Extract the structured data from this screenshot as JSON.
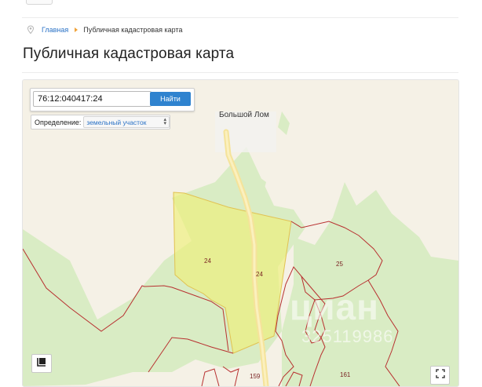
{
  "breadcrumb": {
    "home_label": "Главная",
    "current_label": "Публичная кадастровая карта"
  },
  "page": {
    "title": "Публичная кадастровая карта"
  },
  "search": {
    "cadastral_number": "76:12:040417:24",
    "find_button_label": "Найти"
  },
  "definition": {
    "label": "Определение:",
    "selected_option": "земельный участок"
  },
  "map": {
    "place_label": "Большой Лом",
    "parcel_labels": {
      "p24a": "24",
      "p24b": "24",
      "p25": "25",
      "p159": "159",
      "p161": "161"
    },
    "watermark_brand": "циан",
    "watermark_phone": "325119986",
    "colors": {
      "land": "#f5f1e6",
      "forest": "#d9ecc4",
      "selected_parcel": "#eef07a",
      "parcel_border": "#b83030",
      "road": "#f5e39a",
      "accent": "#2f83cf"
    }
  },
  "icons": {
    "breadcrumb": "map-pin-icon",
    "layers": "layers-icon",
    "fullscreen": "fullscreen-icon"
  }
}
